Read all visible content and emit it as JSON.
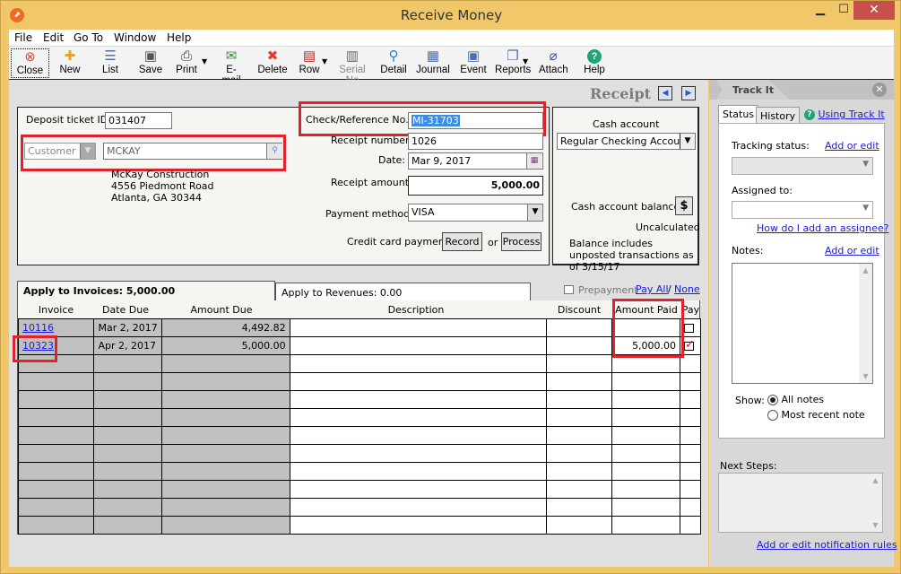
{
  "window": {
    "title": "Receive Money",
    "minimize_icon": "minimize-icon",
    "maximize_icon": "maximize-icon",
    "close_icon": "close-x-icon"
  },
  "menu": [
    "File",
    "Edit",
    "Go To",
    "Window",
    "Help"
  ],
  "toolbar": [
    {
      "label": "Close",
      "icon": "close-circle-icon",
      "glyph": "✖",
      "enabled": true
    },
    {
      "label": "New",
      "icon": "new-document-icon",
      "glyph": "✚",
      "enabled": true
    },
    {
      "label": "List",
      "icon": "list-icon",
      "glyph": "☰",
      "enabled": true
    },
    {
      "label": "Save",
      "icon": "save-disk-icon",
      "glyph": "💾",
      "enabled": true
    },
    {
      "label": "Print",
      "icon": "printer-icon",
      "glyph": "🖶",
      "enabled": true,
      "dropdown": true
    },
    {
      "label": "E-mail",
      "icon": "email-globe-icon",
      "glyph": "✉",
      "enabled": true
    },
    {
      "label": "Delete",
      "icon": "delete-x-icon",
      "glyph": "✖",
      "enabled": true
    },
    {
      "label": "Row",
      "icon": "row-grid-icon",
      "glyph": "▤",
      "enabled": true,
      "dropdown": true
    },
    {
      "label": "Serial No",
      "icon": "barcode-icon",
      "glyph": "▥",
      "enabled": false
    },
    {
      "label": "Detail",
      "icon": "magnifier-icon",
      "glyph": "🔍",
      "enabled": true
    },
    {
      "label": "Journal",
      "icon": "journal-icon",
      "glyph": "▦",
      "enabled": true
    },
    {
      "label": "Event",
      "icon": "event-icon",
      "glyph": "▣",
      "enabled": true
    },
    {
      "label": "Reports",
      "icon": "reports-icon",
      "glyph": "❐",
      "enabled": true,
      "dropdown": true
    },
    {
      "label": "Attach",
      "icon": "paperclip-icon",
      "glyph": "📎",
      "enabled": true
    },
    {
      "label": "Help",
      "icon": "help-circle-icon",
      "glyph": "?",
      "enabled": true
    }
  ],
  "receipt": {
    "heading": "Receipt",
    "deposit_ticket_label": "Deposit ticket ID:",
    "deposit_ticket_value": "031407",
    "customer_id_label": "Customer ID",
    "customer_id_value": "MCKAY",
    "customer_name": "McKay Construction",
    "customer_address1": "4556 Piedmont Road",
    "customer_address2": "Atlanta, GA 30344",
    "check_ref_label": "Check/Reference No.:",
    "check_ref_value": "MI-31703",
    "receipt_number_label": "Receipt number:",
    "receipt_number_value": "1026",
    "date_label": "Date:",
    "date_value": "Mar 9, 2017",
    "receipt_amount_label": "Receipt amount:",
    "receipt_amount_value": "5,000.00",
    "payment_method_label": "Payment method:",
    "payment_method_value": "VISA",
    "credit_card_label": "Credit card payment:",
    "record_button": "Record",
    "or_text": "or",
    "process_button": "Process"
  },
  "cash": {
    "account_label": "Cash account",
    "account_value": "Regular Checking Account",
    "balance_label": "Cash account balance",
    "balance_button_glyph": "$",
    "balance_value": "Uncalculated",
    "balance_note": "Balance includes unposted transactions as of 3/15/17"
  },
  "tabs": {
    "invoices": "Apply to Invoices: 5,000.00",
    "revenues": "Apply to Revenues: 0.00",
    "prepayment_label": "Prepayment",
    "prepayment_checked": false,
    "pay_all": "Pay All",
    "slash": "/",
    "none": "None"
  },
  "grid": {
    "headers": [
      "Invoice",
      "Date Due",
      "Amount Due",
      "Description",
      "Discount",
      "Amount Paid",
      "Pay"
    ],
    "rows": [
      {
        "invoice": "10116",
        "date_due": "Mar 2, 2017",
        "amount_due": "4,492.82",
        "description": "",
        "discount": "",
        "amount_paid": "",
        "pay": false
      },
      {
        "invoice": "10323",
        "date_due": "Apr 2, 2017",
        "amount_due": "5,000.00",
        "description": "",
        "discount": "",
        "amount_paid": "5,000.00",
        "pay": true
      }
    ],
    "empty_rows": 10
  },
  "trackit": {
    "title": "Track It",
    "tab_status": "Status",
    "tab_history": "History",
    "using_link": "Using Track It",
    "tracking_status_label": "Tracking status:",
    "add_or_edit": "Add or edit",
    "tracking_status_value": "",
    "assigned_to_label": "Assigned to:",
    "assigned_to_value": "",
    "how_add_assignee": "How do I add an assignee?",
    "notes_label": "Notes:",
    "show_label": "Show:",
    "show_options": [
      {
        "label": "All notes",
        "selected": true
      },
      {
        "label": "Most recent note",
        "selected": false
      }
    ],
    "next_steps_label": "Next Steps:",
    "notification_link": "Add or edit notification rules"
  },
  "colors": {
    "window_frame": "#f0c86a",
    "highlight_red": "#e0232b",
    "link_blue": "#1a1ad8",
    "selection_blue": "#3a8ee6",
    "check_red": "#d0101a",
    "readonly_gray": "#c0c0c0"
  }
}
